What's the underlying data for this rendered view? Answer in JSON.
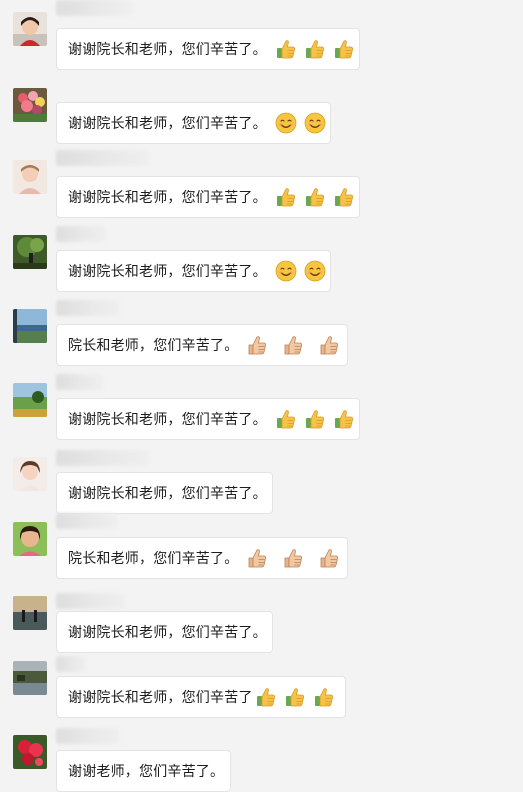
{
  "messages": [
    {
      "text": "谢谢院长和老师，您们辛苦了。",
      "emojis": [
        "thumbs-up-icon",
        "thumbs-up-icon",
        "thumbs-up-icon"
      ]
    },
    {
      "text": "谢谢院长和老师，您们辛苦了。",
      "emojis": [
        "smile-icon",
        "smile-icon"
      ]
    },
    {
      "text": "谢谢院长和老师，您们辛苦了。",
      "emojis": [
        "thumbs-up-icon",
        "thumbs-up-icon",
        "thumbs-up-icon"
      ]
    },
    {
      "text": "谢谢院长和老师，您们辛苦了。",
      "emojis": [
        "smile-icon",
        "smile-icon"
      ]
    },
    {
      "text": "院长和老师，您们辛苦了。",
      "emojis": [
        "thumbs-up-skin-icon",
        "thumbs-up-skin-icon",
        "thumbs-up-skin-icon"
      ]
    },
    {
      "text": "谢谢院长和老师，您们辛苦了。",
      "emojis": [
        "thumbs-up-icon",
        "thumbs-up-icon",
        "thumbs-up-icon"
      ]
    },
    {
      "text": "谢谢院长和老师，您们辛苦了。",
      "emojis": []
    },
    {
      "text": "院长和老师，您们辛苦了。",
      "emojis": [
        "thumbs-up-skin-icon",
        "thumbs-up-skin-icon",
        "thumbs-up-skin-icon"
      ]
    },
    {
      "text": "谢谢院长和老师，您们辛苦了。",
      "emojis": []
    },
    {
      "text": "谢谢院长和老师，您们辛苦了",
      "emojis": [
        "thumbs-up-icon",
        "thumbs-up-icon",
        "thumbs-up-icon"
      ]
    },
    {
      "text": "谢谢老师，您们辛苦了。",
      "emojis": []
    }
  ],
  "colors": {
    "background": "#f3f3f3",
    "bubble": "#ffffff",
    "bubble_border": "#e3e3e3",
    "text": "#1c1c1c"
  }
}
